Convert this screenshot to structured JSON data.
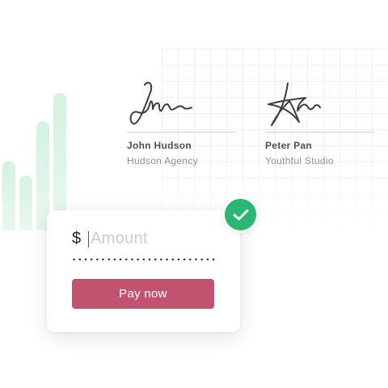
{
  "signers": [
    {
      "name": "John Hudson",
      "company": "Hudson Agency"
    },
    {
      "name": "Peter Pan",
      "company": "Youthful Studio"
    }
  ],
  "payment": {
    "currency_symbol": "$",
    "amount_placeholder": "Amount",
    "amount_value": "",
    "button_label": "Pay now"
  },
  "colors": {
    "pay_button": "#c25370",
    "success_badge": "#2bb673",
    "bars": "#d4f1e1",
    "grid": "#ecc8d2"
  },
  "icons": {
    "status": "checkmark-icon"
  }
}
